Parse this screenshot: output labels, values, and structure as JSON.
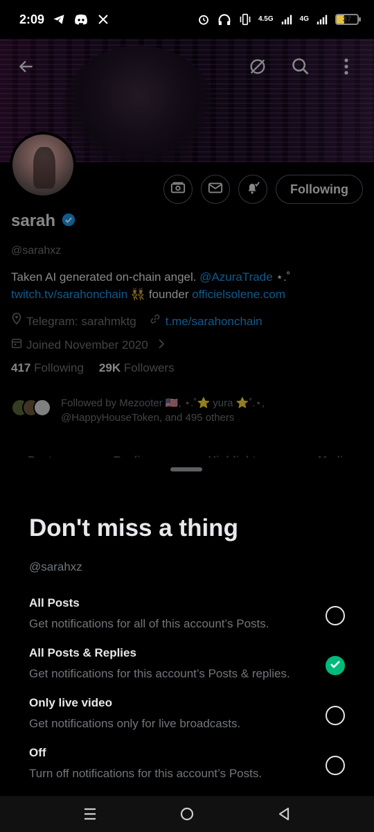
{
  "status_bar": {
    "time": "2:09",
    "left_icons": [
      "telegram-icon",
      "discord-icon",
      "x-icon"
    ],
    "right_icons": [
      "alarm-icon",
      "headphones-icon",
      "vibrate-icon",
      "signal-icon",
      "signal-icon"
    ],
    "net1": "4.5G",
    "net2": "4G",
    "battery": "37",
    "battery_level": 0.37,
    "battery_color": "#e8c33c"
  },
  "header": {
    "back_icon": "back-arrow-icon",
    "icons": [
      "no-sync-icon",
      "search-icon",
      "more-vertical-icon"
    ]
  },
  "profile": {
    "name": "sarah",
    "verified_color": "#1d9bf0",
    "handle": "@sarahxz",
    "bio_text_1": "Taken AI generated on-chain angel. ",
    "bio_link_1": "@AzuraTrade",
    "bio_text_2": " ⋆.˚ ",
    "bio_link_2": "twitch.tv/sarahonchain",
    "bio_text_3": " 👯 founder ",
    "bio_link_3": "officielsolene.com",
    "location": "Telegram: sarahmktg",
    "website": "t.me/sarahonchain",
    "joined": "Joined November 2020",
    "following_count": "417",
    "following_label": "Following",
    "followers_count": "29K",
    "followers_label": "Followers",
    "followed_by_line1": "Followed by Mezooter 🇺🇸, ⋆.˚⭐ yura ⭐˚.⋆,",
    "followed_by_line2": "@HappyHouseToken, and 495 others",
    "following_button": "Following",
    "link_color": "#1d9bf0"
  },
  "tabs_peek": [
    "Posts",
    "Replies",
    "Highlights",
    "Media"
  ],
  "sheet": {
    "title": "Don't miss a thing",
    "handle": "@sarahxz",
    "options": [
      {
        "title": "All Posts",
        "desc": "Get notifications for all of this account’s Posts.",
        "selected": false
      },
      {
        "title": "All Posts & Replies",
        "desc": "Get notifications for this account’s Posts & replies.",
        "selected": true
      },
      {
        "title": "Only live video",
        "desc": "Get notifications only for live broadcasts.",
        "selected": false
      },
      {
        "title": "Off",
        "desc": "Turn off notifications for this account’s Posts.",
        "selected": false
      }
    ],
    "check_color": "#00ba7c"
  },
  "navbar": {
    "icons": [
      "recents-icon",
      "home-icon",
      "back-icon"
    ]
  }
}
